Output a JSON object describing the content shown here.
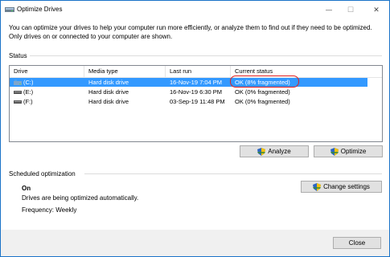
{
  "window": {
    "title": "Optimize Drives"
  },
  "controls": {
    "minimize": "—",
    "maximize": "☐",
    "close": "✕"
  },
  "description": "You can optimize your drives to help your computer run more efficiently, or analyze them to find out if they need to be optimized. Only drives on or connected to your computer are shown.",
  "status": {
    "label": "Status",
    "columns": [
      "Drive",
      "Media type",
      "Last run",
      "Current status"
    ],
    "rows": [
      {
        "drive": "(C:)",
        "media": "Hard disk drive",
        "last_run": "16-Nov-19 7:04 PM",
        "status": "OK (8% fragmented)",
        "icon": "windows-drive-icon",
        "selected": true
      },
      {
        "drive": "(E:)",
        "media": "Hard disk drive",
        "last_run": "16-Nov-19 6:30 PM",
        "status": "OK (0% fragmented)",
        "icon": "drive-icon",
        "selected": false
      },
      {
        "drive": "(F:)",
        "media": "Hard disk drive",
        "last_run": "03-Sep-19 11:48 PM",
        "status": "OK (0% fragmented)",
        "icon": "drive-icon",
        "selected": false
      }
    ]
  },
  "buttons": {
    "analyze": "Analyze",
    "optimize": "Optimize",
    "change_settings": "Change settings",
    "close": "Close"
  },
  "scheduled": {
    "label": "Scheduled optimization",
    "state": "On",
    "message": "Drives are being optimized automatically.",
    "frequency": "Frequency: Weekly"
  },
  "colors": {
    "selection": "#3399ff",
    "highlight": "#e02020",
    "accent_border": "#1a73c8"
  }
}
